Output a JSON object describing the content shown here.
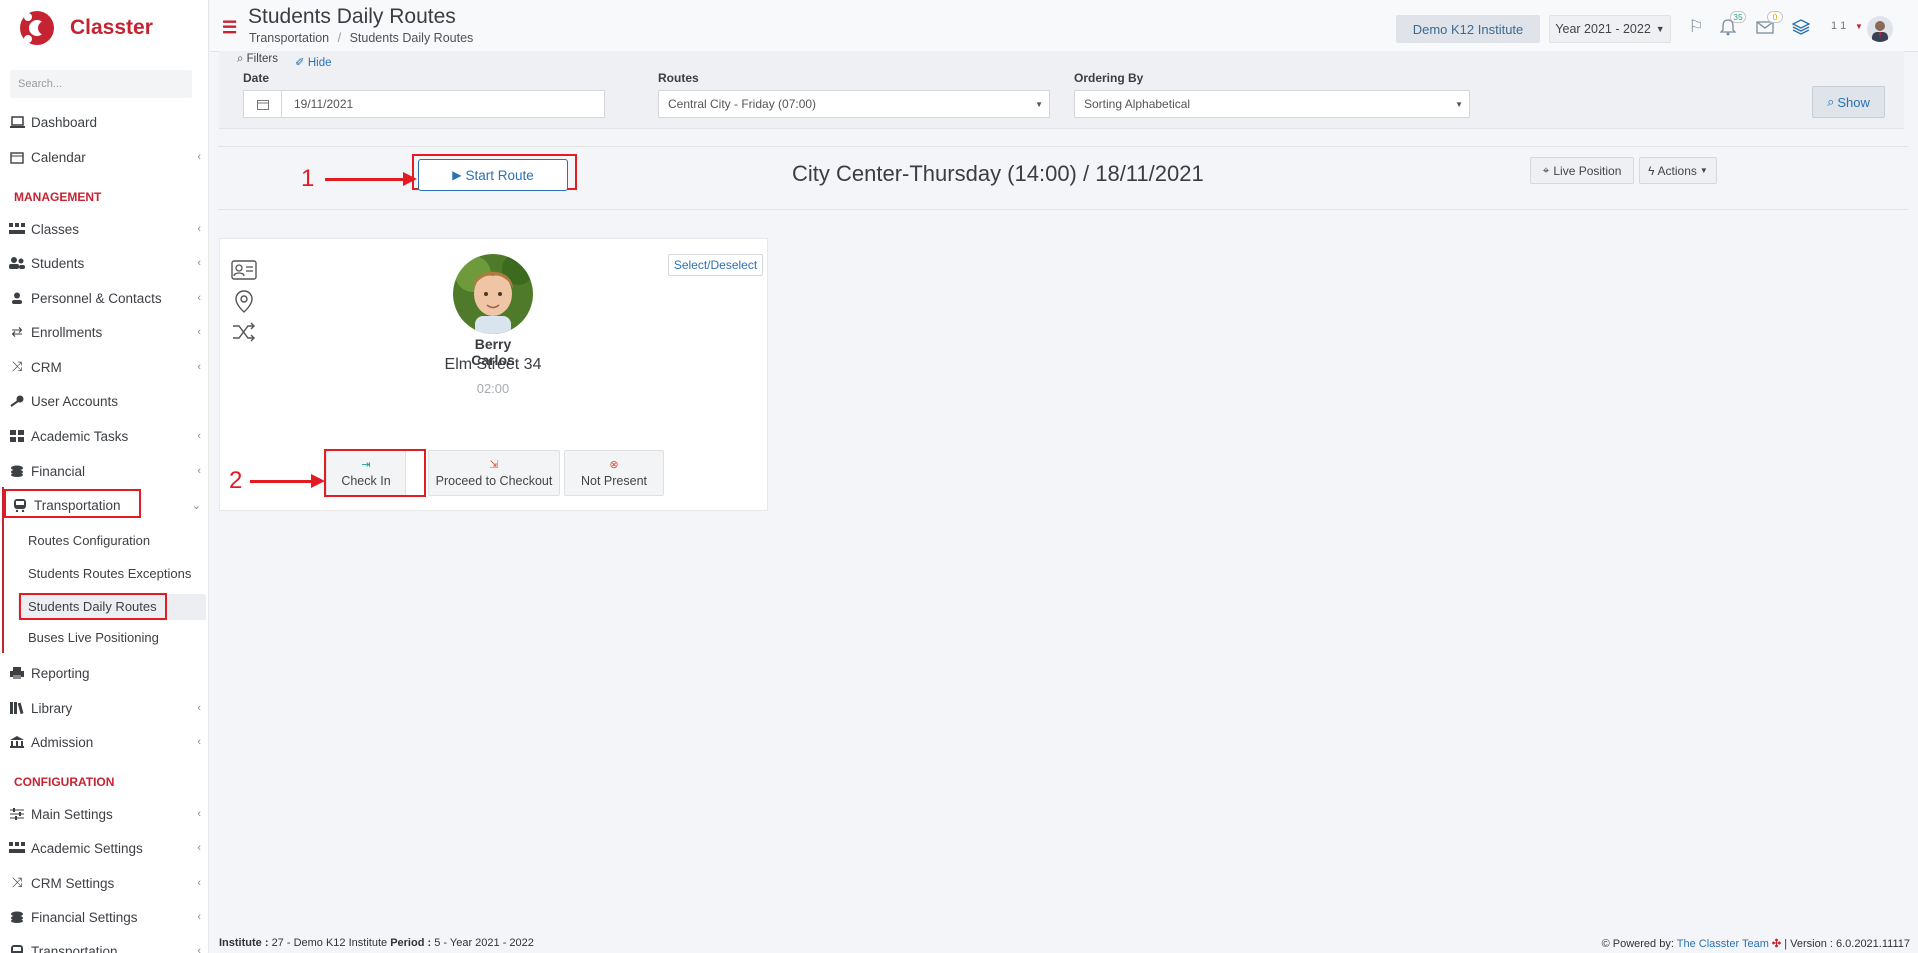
{
  "app": {
    "name": "Classter"
  },
  "search": {
    "placeholder": "Search..."
  },
  "sidebar": {
    "items": [
      {
        "label": "Dashboard",
        "icon": "laptop-icon"
      },
      {
        "label": "Calendar",
        "icon": "calendar-icon"
      },
      {
        "label": "MANAGEMENT"
      },
      {
        "label": "Classes",
        "icon": "classes-icon"
      },
      {
        "label": "Students",
        "icon": "students-icon"
      },
      {
        "label": "Personnel & Contacts",
        "icon": "person-icon"
      },
      {
        "label": "Enrollments",
        "icon": "exchange-icon"
      },
      {
        "label": "CRM",
        "icon": "shuffle-icon"
      },
      {
        "label": "User Accounts",
        "icon": "key-icon"
      },
      {
        "label": "Academic Tasks",
        "icon": "grid-icon"
      },
      {
        "label": "Financial",
        "icon": "coins-icon"
      },
      {
        "label": "Transportation",
        "icon": "bus-icon"
      },
      {
        "label": "Reporting",
        "icon": "print-icon"
      },
      {
        "label": "Library",
        "icon": "books-icon"
      },
      {
        "label": "Admission",
        "icon": "institution-icon"
      },
      {
        "label": "CONFIGURATION"
      },
      {
        "label": "Main Settings",
        "icon": "sliders-icon"
      },
      {
        "label": "Academic Settings",
        "icon": "classes-icon"
      },
      {
        "label": "CRM Settings",
        "icon": "shuffle-icon"
      },
      {
        "label": "Financial Settings",
        "icon": "coins-icon"
      },
      {
        "label": "Transportation",
        "icon": "bus-icon"
      }
    ],
    "transport_sub": [
      "Routes Configuration",
      "Students Routes Exceptions",
      "Students Daily Routes",
      "Buses Live Positioning"
    ]
  },
  "header": {
    "title": "Students Daily Routes",
    "breadcrumb": [
      "Transportation",
      "Students Daily Routes"
    ],
    "institute": "Demo K12 Institute",
    "year": "Year 2021 - 2022",
    "notifications": "35",
    "messages": "0",
    "user": "1 1"
  },
  "filters": {
    "toggle": "Filters",
    "hide": "Hide",
    "date_label": "Date",
    "date_value": "19/11/2021",
    "routes_label": "Routes",
    "routes_value": "Central City - Friday (07:00)",
    "ordering_label": "Ordering By",
    "ordering_value": "Sorting Alphabetical",
    "show": "Show"
  },
  "route": {
    "start": "Start Route",
    "title": "City Center-Thursday (14:00) / 18/11/2021",
    "live": "Live Position",
    "actions": "Actions"
  },
  "student": {
    "select": "Select/Deselect",
    "name": "Berry Carlos",
    "address": "Elm Street 34",
    "time": "02:00",
    "check_in": "Check In",
    "checkout": "Proceed to Checkout",
    "not_present": "Not Present"
  },
  "annotations": {
    "step1": "1",
    "step2": "2"
  },
  "footer": {
    "institute_label": "Institute :",
    "institute_value": "27 - Demo K12 Institute",
    "period_label": "Period :",
    "period_value": "5 - Year 2021 - 2022",
    "powered": "Powered by:",
    "team": "The Classter Team",
    "version": "| Version : 6.0.2021.11117"
  },
  "colors": {
    "brand": "#c62332",
    "accent": "#2a72b5",
    "annotation": "#e31b23"
  }
}
